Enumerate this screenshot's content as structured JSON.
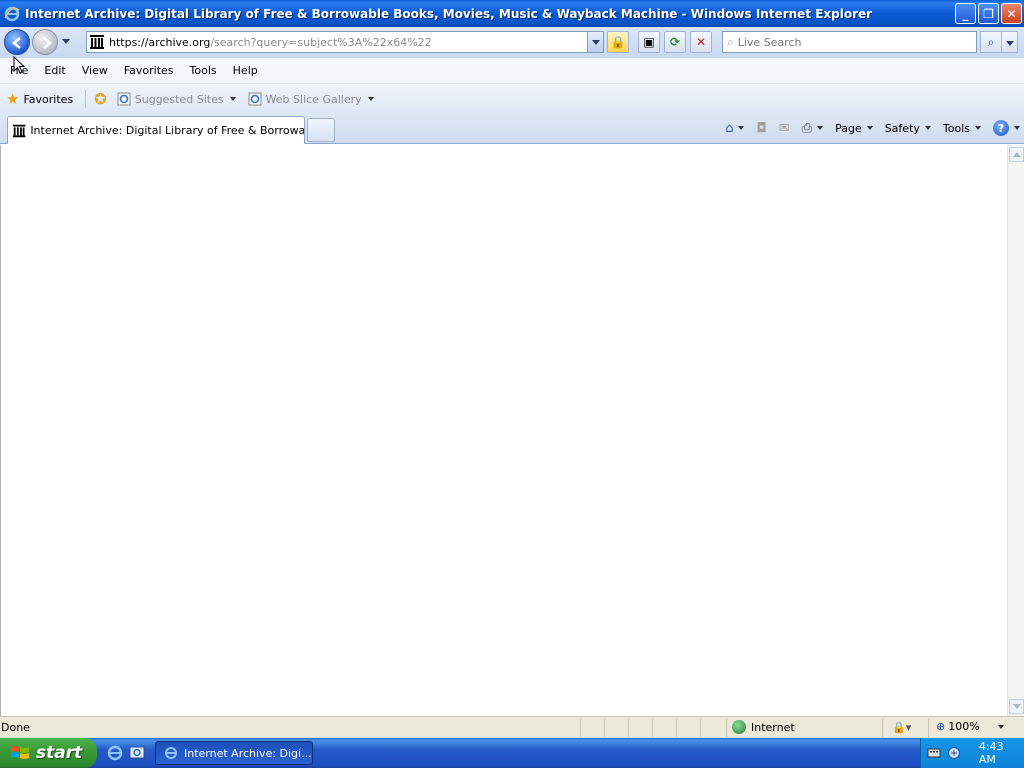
{
  "window": {
    "title": "Internet Archive: Digital Library of Free & Borrowable Books, Movies, Music & Wayback Machine - Windows Internet Explorer",
    "buttons": {
      "minimize": "_",
      "maximize": "❐",
      "close": "✕"
    }
  },
  "address_bar": {
    "url_host": "https://archive.org",
    "url_path": "/search?query=subject%3A%22x64%22"
  },
  "search": {
    "placeholder": "Live Search"
  },
  "menu": {
    "items": [
      "File",
      "Edit",
      "View",
      "Favorites",
      "Tools",
      "Help"
    ]
  },
  "favorites_bar": {
    "favorites_label": "Favorites",
    "links": [
      "Suggested Sites",
      "Web Slice Gallery"
    ]
  },
  "tabs": [
    {
      "label": "Internet Archive: Digital Library of Free & Borrowable ..."
    }
  ],
  "command_bar": {
    "page": "Page",
    "safety": "Safety",
    "tools": "Tools"
  },
  "status_bar": {
    "text": "Done",
    "zone": "Internet",
    "zoom": "100%"
  },
  "taskbar": {
    "start_label": "start",
    "task_label": "Internet Archive: Digi...",
    "clock": "4:43 AM"
  },
  "colors": {
    "titlebar": "#0a5bd5",
    "taskbar": "#2459c8",
    "start": "#3b9b38"
  }
}
